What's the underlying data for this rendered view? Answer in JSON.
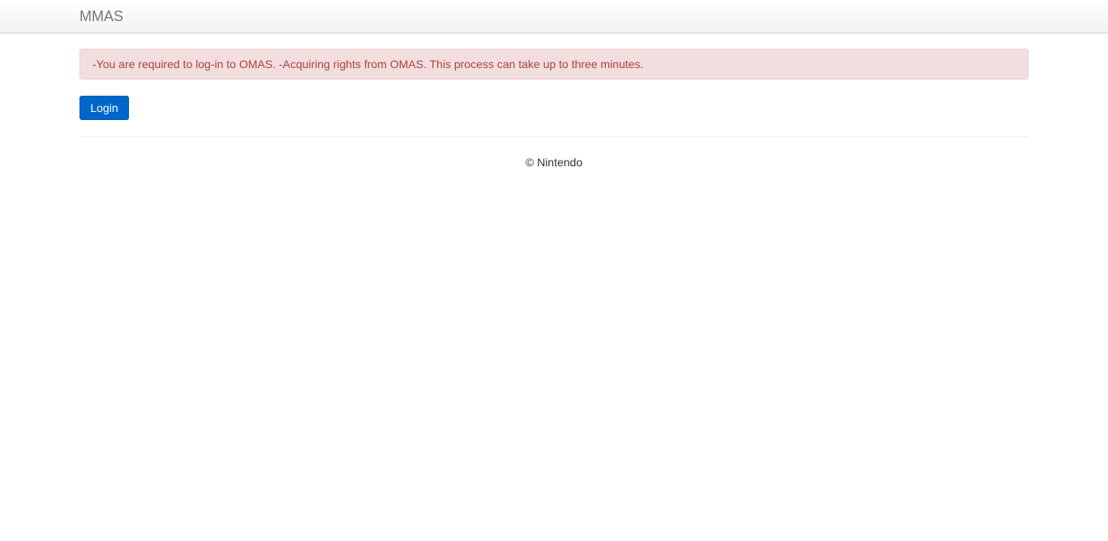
{
  "navbar": {
    "brand": "MMAS"
  },
  "alert": {
    "message": "-You are required to log-in to OMAS. -Acquiring rights from OMAS. This process can take up to three minutes."
  },
  "actions": {
    "login_label": "Login"
  },
  "footer": {
    "copyright": "© Nintendo"
  },
  "colors": {
    "primary_button": "#0066cc",
    "alert_background": "#f2dede",
    "alert_text": "#a94442",
    "brand_text": "#777777"
  }
}
